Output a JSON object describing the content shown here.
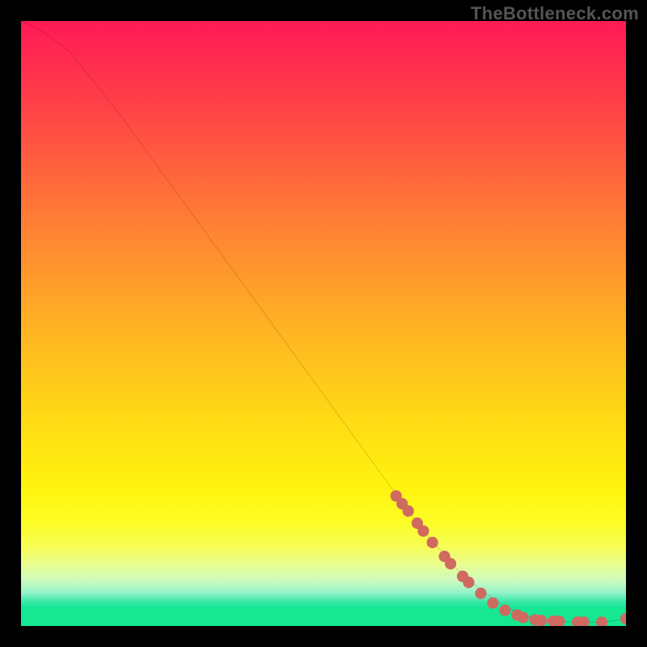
{
  "watermark": "TheBottleneck.com",
  "chart_data": {
    "type": "line",
    "title": "",
    "xlabel": "",
    "ylabel": "",
    "xlim": [
      0,
      100
    ],
    "ylim": [
      0,
      100
    ],
    "grid": false,
    "legend": false,
    "series": [
      {
        "name": "curve",
        "x": [
          0,
          4,
          8,
          12,
          16,
          20,
          24,
          28,
          32,
          36,
          40,
          44,
          48,
          52,
          56,
          60,
          64,
          68,
          72,
          76,
          80,
          84,
          88,
          92,
          96,
          100
        ],
        "y": [
          100,
          98,
          95,
          90,
          85,
          79.5,
          74,
          68.5,
          63,
          57.5,
          52,
          46.5,
          41,
          35.5,
          30,
          24.5,
          19,
          14,
          9.5,
          6,
          3.2,
          1.6,
          0.8,
          0.6,
          0.6,
          1.2
        ]
      }
    ],
    "markers": [
      {
        "x": 62,
        "y": 21.5
      },
      {
        "x": 63,
        "y": 20.2
      },
      {
        "x": 64,
        "y": 19.0
      },
      {
        "x": 65.5,
        "y": 17.0
      },
      {
        "x": 66.5,
        "y": 15.7
      },
      {
        "x": 68,
        "y": 13.8
      },
      {
        "x": 70,
        "y": 11.5
      },
      {
        "x": 71,
        "y": 10.3
      },
      {
        "x": 73,
        "y": 8.2
      },
      {
        "x": 74,
        "y": 7.2
      },
      {
        "x": 76,
        "y": 5.4
      },
      {
        "x": 78,
        "y": 3.8
      },
      {
        "x": 80,
        "y": 2.6
      },
      {
        "x": 82,
        "y": 1.8
      },
      {
        "x": 83,
        "y": 1.4
      },
      {
        "x": 85,
        "y": 1.0
      },
      {
        "x": 86,
        "y": 0.9
      },
      {
        "x": 88,
        "y": 0.8
      },
      {
        "x": 89,
        "y": 0.75
      },
      {
        "x": 92,
        "y": 0.65
      },
      {
        "x": 93,
        "y": 0.63
      },
      {
        "x": 96,
        "y": 0.62
      },
      {
        "x": 100,
        "y": 1.2
      }
    ],
    "marker_color": "#cf6a60",
    "line_color": "#000000"
  }
}
